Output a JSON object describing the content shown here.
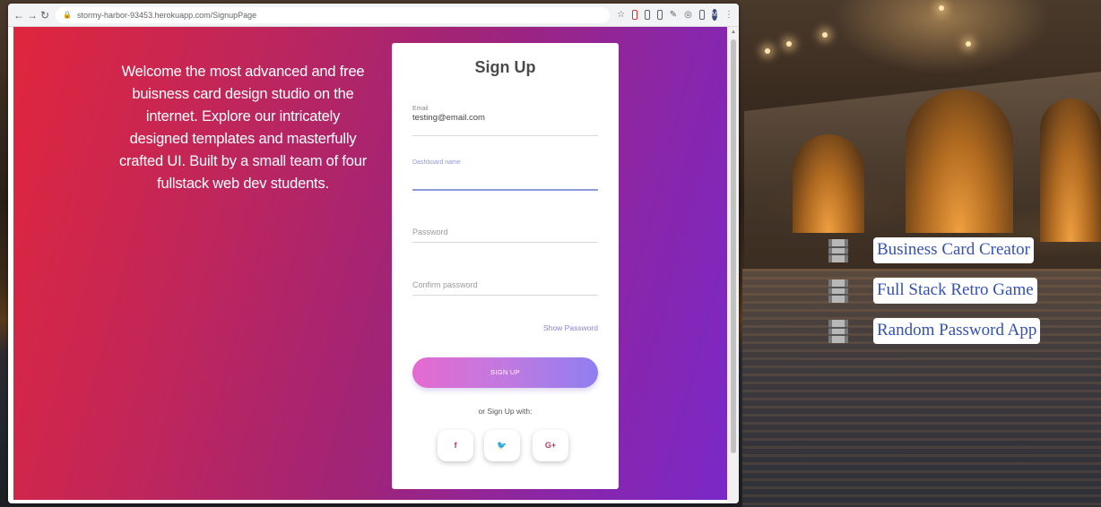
{
  "browser": {
    "url_host": "stormy-harbor-93453.herokuapp.com",
    "url_path": "/SignupPage",
    "profile_initial": "M"
  },
  "page": {
    "welcome_text": "Welcome the most advanced and free buisness card design studio on the internet. Explore our intricately designed templates and masterfully crafted UI. Built by a small team of four fullstack web dev students.",
    "title": "Sign Up",
    "fields": {
      "email_label": "Email",
      "email_value": "testing@email.com",
      "dashboard_label": "Dashboard name",
      "password_placeholder": "Password",
      "confirm_placeholder": "Confirm password"
    },
    "show_password": "Show Password",
    "signup_button": "SIGN UP",
    "or_text": "or Sign Up with:",
    "social": {
      "facebook": "f",
      "twitter": "🐦",
      "google": "G+"
    }
  },
  "desktop": {
    "shortcuts": [
      {
        "label": "Business Card Creator",
        "icon": "film-icon"
      },
      {
        "label": "Full Stack Retro Game",
        "icon": "film-icon"
      },
      {
        "label": "Random Password App",
        "icon": "film-icon"
      }
    ]
  },
  "colors": {
    "gradient_start": "#e0263d",
    "gradient_end": "#7a28c8",
    "accent": "#8e9bd8",
    "button_start": "#e56ad0",
    "button_end": "#8f7ef0"
  }
}
